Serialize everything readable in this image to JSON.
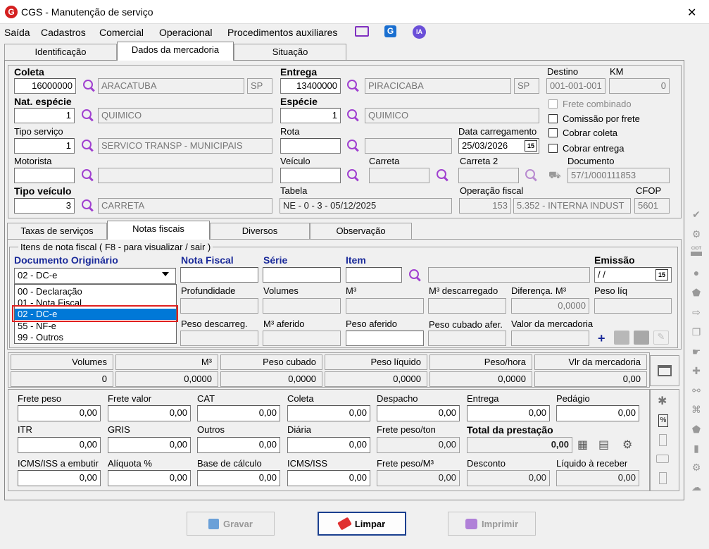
{
  "window": {
    "title": "CGS - Manutenção de serviço",
    "close": "✕"
  },
  "menu": [
    "Saída",
    "Cadastros",
    "Comercial",
    "Operacional",
    "Procedimentos auxiliares"
  ],
  "top_tabs": [
    "Identificação",
    "Dados da mercadoria",
    "Situação"
  ],
  "header": {
    "coleta_label": "Coleta",
    "coleta_code": "16000000",
    "coleta_city": "ARACATUBA",
    "coleta_uf": "SP",
    "entrega_label": "Entrega",
    "entrega_code": "13400000",
    "entrega_city": "PIRACICABA",
    "entrega_uf": "SP",
    "destino_label": "Destino",
    "destino_value": "001-001-001",
    "km_label": "KM",
    "km_value": "0",
    "natesp_label": "Nat. espécie",
    "natesp_code": "1",
    "natesp_desc": "QUIMICO",
    "especie_label": "Espécie",
    "especie_code": "1",
    "especie_desc": "QUIMICO",
    "frete_combinado": "Frete combinado",
    "comissao": "Comissão por frete",
    "cobrar_coleta": "Cobrar coleta",
    "cobrar_entrega": "Cobrar entrega",
    "tiposerv_label": "Tipo serviço",
    "tiposerv_code": "1",
    "tiposerv_desc": "SERVICO TRANSP - MUNICIPAIS",
    "rota_label": "Rota",
    "datacarr_label": "Data carregamento",
    "datacarr_value": "25/03/2026",
    "cal_num": "15",
    "motorista_label": "Motorista",
    "veiculo_label": "Veículo",
    "carreta_label": "Carreta",
    "carreta2_label": "Carreta 2",
    "documento_label": "Documento",
    "documento_value": "57/1/000111853",
    "tipoveic_label": "Tipo veículo",
    "tipoveic_code": "3",
    "tipoveic_desc": "CARRETA",
    "tabela_label": "Tabela",
    "tabela_value": "NE - 0 - 3 - 05/12/2025",
    "opfiscal_label": "Operação fiscal",
    "opfiscal_code": "153",
    "opfiscal_desc": "5.352 - INTERNA INDUST",
    "cfop_label": "CFOP",
    "cfop_value": "5601"
  },
  "inner_tabs": [
    "Taxas de serviços",
    "Notas fiscais",
    "Diversos",
    "Observação"
  ],
  "nf": {
    "group_title": "Itens de nota fiscal ( F8 - para visualizar / sair )",
    "doc_orig_label": "Documento Originário",
    "doc_orig_value": "02 - DC-e",
    "options": [
      "00 - Declaração",
      "01 - Nota Fiscal",
      "02 - DC-e",
      "55 - NF-e",
      "99 - Outros"
    ],
    "nota_fiscal_label": "Nota Fiscal",
    "serie_label": "Série",
    "item_label": "Item",
    "emissao_label": "Emissão",
    "emissao_value": " / /",
    "cal_num": "15",
    "profundidade": "Profundidade",
    "volumes": "Volumes",
    "m3": "M³",
    "m3_desc": "M³ descarregado",
    "dif_m3": "Diferença. M³",
    "dif_m3_value": "0,0000",
    "peso_liq": "Peso líq",
    "peso_descarreg": "Peso descarreg.",
    "m3_aferido": "M³ aferido",
    "peso_aferido": "Peso aferido",
    "peso_cubado_afer": "Peso cubado afer.",
    "valor_merc": "Valor da mercadoria"
  },
  "summary": {
    "headers": [
      "Volumes",
      "M³",
      "Peso cubado",
      "Peso líquido",
      "Peso/hora",
      "Vlr da mercadoria"
    ],
    "values": [
      "0",
      "0,0000",
      "0,0000",
      "0,0000",
      "0,0000",
      "0,00"
    ]
  },
  "freight": {
    "row1": [
      {
        "label": "Frete peso",
        "value": "0,00"
      },
      {
        "label": "Frete valor",
        "value": "0,00"
      },
      {
        "label": "CAT",
        "value": "0,00"
      },
      {
        "label": "Coleta",
        "value": "0,00"
      },
      {
        "label": "Despacho",
        "value": "0,00"
      },
      {
        "label": "Entrega",
        "value": "0,00"
      },
      {
        "label": "Pedágio",
        "value": "0,00"
      }
    ],
    "row2": [
      {
        "label": "ITR",
        "value": "0,00"
      },
      {
        "label": "GRIS",
        "value": "0,00"
      },
      {
        "label": "Outros",
        "value": "0,00"
      },
      {
        "label": "Diária",
        "value": "0,00"
      },
      {
        "label": "Frete peso/ton",
        "value": "0,00"
      },
      {
        "label": "Total da prestação",
        "value": "0,00"
      }
    ],
    "row3": [
      {
        "label": "ICMS/ISS a embutir",
        "value": "0,00"
      },
      {
        "label": "Alíquota %",
        "value": "0,00"
      },
      {
        "label": "Base de cálculo",
        "value": "0,00"
      },
      {
        "label": "ICMS/ISS",
        "value": "0,00"
      },
      {
        "label": "Frete peso/M³",
        "value": "0,00"
      },
      {
        "label": "Desconto",
        "value": "0,00"
      },
      {
        "label": "Líquido à receber",
        "value": "0,00"
      }
    ]
  },
  "buttons": {
    "gravar": "Gravar",
    "limpar": "Limpar",
    "imprimir": "Imprimir"
  },
  "colors": {
    "accent_purple": "#a040d0",
    "label_blue": "#1a2a9a",
    "selection": "#0078d7",
    "highlight_border": "#e02020"
  }
}
